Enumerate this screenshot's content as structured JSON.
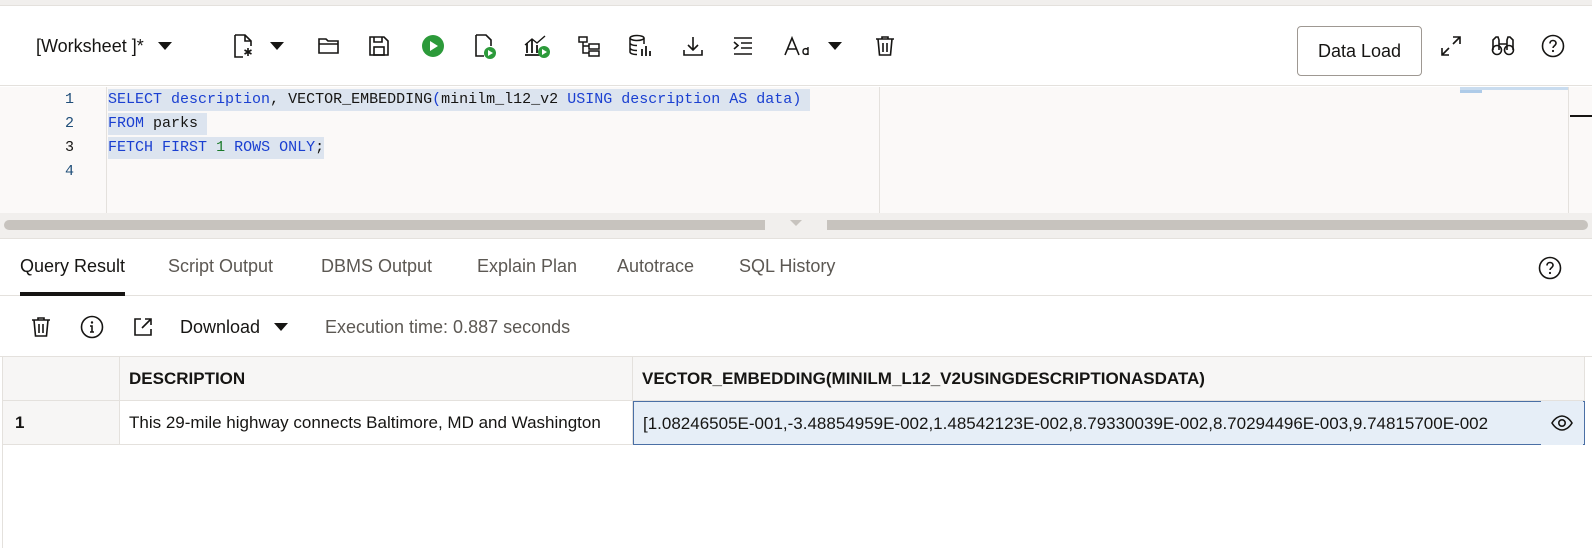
{
  "toolbar": {
    "worksheet_label": "[Worksheet ]*",
    "data_load_label": "Data Load",
    "icons": [
      "new-file-icon",
      "open-folder-icon",
      "save-icon",
      "run-statement-icon",
      "run-script-icon",
      "chart-icon",
      "explain-plan-icon",
      "database-icon",
      "download-icon",
      "format-icon",
      "font-size-icon",
      "delete-icon",
      "expand-icon",
      "binoculars-icon",
      "help-icon"
    ]
  },
  "editor": {
    "line_numbers": [
      "1",
      "2",
      "3",
      "4"
    ],
    "lines": [
      "SELECT description, VECTOR_EMBEDDING(minilm_l12_v2 USING description AS data)",
      "FROM parks",
      "FETCH FIRST 1 ROWS ONLY;",
      ""
    ],
    "tokens": {
      "select": "SELECT",
      "description": "description",
      "comma": ",",
      "vector_embedding": "VECTOR_EMBEDDING",
      "paren_open": "(",
      "model": "minilm_l12_v2",
      "using": "USING",
      "description2": "description",
      "as": "AS",
      "data": "data",
      "paren_close": ")",
      "from": "FROM",
      "parks": "parks",
      "fetch": "FETCH",
      "first": "FIRST",
      "one": "1",
      "rows": "ROWS",
      "only": "ONLY",
      "semicolon": ";"
    }
  },
  "tabs": [
    {
      "label": "Query Result",
      "active": true
    },
    {
      "label": "Script Output",
      "active": false
    },
    {
      "label": "DBMS Output",
      "active": false
    },
    {
      "label": "Explain Plan",
      "active": false
    },
    {
      "label": "Autotrace",
      "active": false
    },
    {
      "label": "SQL History",
      "active": false
    }
  ],
  "result_toolbar": {
    "download_label": "Download",
    "execution_time": "Execution time: 0.887 seconds"
  },
  "grid": {
    "columns": [
      "DESCRIPTION",
      "VECTOR_EMBEDDING(MINILM_L12_V2USINGDESCRIPTIONASDATA)"
    ],
    "rows": [
      {
        "num": "1",
        "description": "This 29-mile highway connects Baltimore, MD and Washington",
        "embedding": "[1.08246505E-001,-3.48854959E-002,1.48542123E-002,8.79330039E-002,8.70294496E-003,9.74815700E-002"
      }
    ]
  },
  "colors": {
    "keyword": "#1a3fd1",
    "number": "#1a7a2a",
    "selection": "#dce4ef",
    "run_green": "#2c9a3a"
  }
}
